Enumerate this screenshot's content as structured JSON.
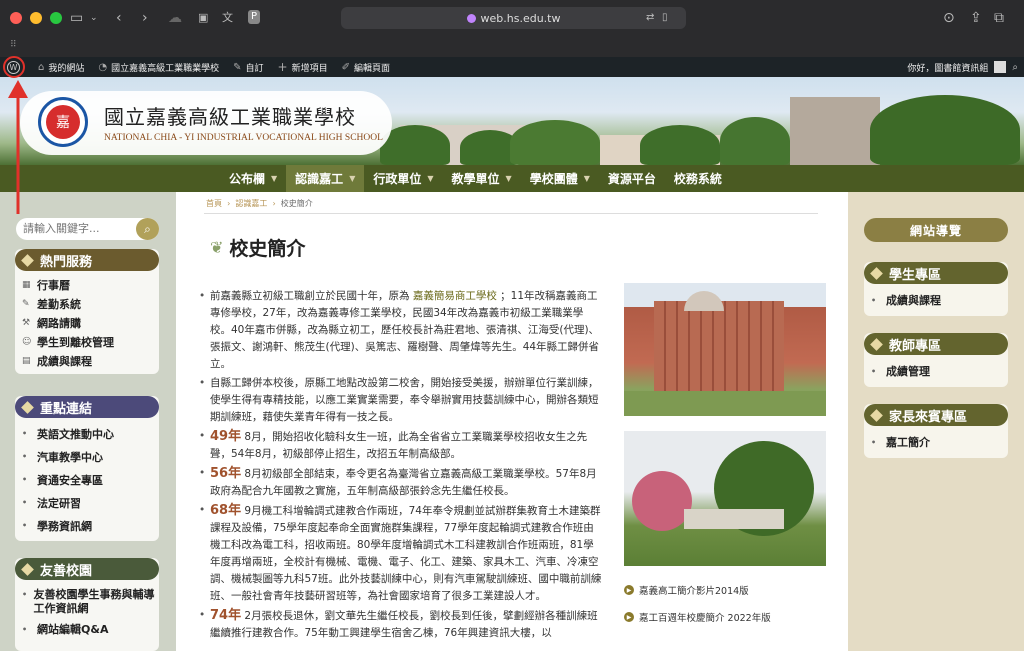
{
  "browser": {
    "url": "web.hs.edu.tw"
  },
  "adminbar": {
    "my_site": "我的網站",
    "site_name": "國立嘉義高級工業職業學校",
    "customize": "自訂",
    "new_item": "新增項目",
    "edit_page": "編輯頁面",
    "greeting": "你好，圖書館資訊組"
  },
  "header": {
    "site_name": "國立嘉義高級工業職業學校",
    "site_name_en": "NATIONAL CHIA - YI INDUSTRIAL VOCATIONAL HIGH SCHOOL",
    "logo_text": "嘉"
  },
  "nav": {
    "items": [
      {
        "label": "公布欄",
        "caret": true
      },
      {
        "label": "認識嘉工",
        "caret": true,
        "active": true
      },
      {
        "label": "行政單位",
        "caret": true
      },
      {
        "label": "教學單位",
        "caret": true
      },
      {
        "label": "學校團體",
        "caret": true
      },
      {
        "label": "資源平台",
        "caret": false
      },
      {
        "label": "校務系統",
        "caret": false
      }
    ]
  },
  "sidebar": {
    "search_placeholder": "請輸入關鍵字...",
    "hot": {
      "title": "熱門服務",
      "color": "#6b5b2e",
      "items": [
        {
          "icon": "calendar-icon",
          "glyph": "▦",
          "label": "行事曆"
        },
        {
          "icon": "pencil-icon",
          "glyph": "✎",
          "label": "差勤系統"
        },
        {
          "icon": "wrench-icon",
          "glyph": "⚒",
          "label": "網路請購"
        },
        {
          "icon": "user-icon",
          "glyph": "☺",
          "label": "學生到離校管理"
        },
        {
          "icon": "list-icon",
          "glyph": "▤",
          "label": "成績與課程"
        }
      ]
    },
    "key": {
      "title": "重點連結",
      "color": "#4c4a7a",
      "items": [
        "英語文推動中心",
        "汽車教學中心",
        "資通安全專區",
        "法定研習",
        "學務資訊網"
      ]
    },
    "friendly": {
      "title": "友善校園",
      "color": "#4a5a3a",
      "items": [
        "友善校園學生事務與輔導工作資訊網",
        "網站編輯Q&A"
      ]
    }
  },
  "breadcrumb": {
    "home": "首頁",
    "sep": "›",
    "section": "認識嘉工",
    "current": "校史簡介"
  },
  "page": {
    "title": "校史簡介"
  },
  "article": {
    "p1_a": "前嘉義縣立初級工職創立於民國十年，原為 ",
    "p1_link": "嘉義簡易商工學校",
    "p1_b": " ；11年改稱嘉義商工專修學校，27年，改為嘉義專修工業學校，民國34年改為嘉義市初級工業職業學校。40年嘉市併縣，改為縣立初工，歷任校長計為莊君地、張清祺、江海受(代理)、張振文、謝鴻軒、熊茂生(代理)、吳篤志、羅樹聲、周肇煒等先生。44年縣工歸併省立。",
    "p2": "自縣工歸併本校後，原縣工地點改設第二校舍，開始接受美援，辦辦單位行業訓練，使學生得有專精技能，以應工業實業需要，奉令舉辦實用技藝訓練中心，開辦各類短期訓練班，藉使失業青年得有一技之長。",
    "y49": "49年",
    "p3": " 8月，開始招收化驗科女生一班，此為全省省立工業職業學校招收女生之先聲，54年8月，初級部停止招生，改招五年制高級部。",
    "y56": "56年",
    "p4": " 8月初級部全部結束，奉令更名為臺灣省立嘉義高級工業職業學校。57年8月政府為配合九年國教之實施，五年制高級部張鈴念先生繼任校長。",
    "y68": "68年",
    "p5": " 9月機工科增輪調式建教合作兩班，74年奉令規劃並試辦群集教育土木建築群課程及設備，75學年度起奉命全面實施群集課程，77學年度起輪調式建教合作班由機工科改為電工科，招收兩班。80學年度增輪調式木工科建教訓合作班兩班，81學年度再增兩班，全校計有機械、電機、電子、化工、建築、家具木工、汽車、冷凍空調、機械製圖等九科57班。此外技藝訓練中心，則有汽車駕駛訓練班、國中職前訓練班、一般社會青年技藝研習班等，為社會國家培育了很多工業建設人才。",
    "y74": "74年",
    "p6": " 2月張校長退休，劉文華先生繼任校長，劉校長到任後，擘劃經辦各種訓練班繼續推行建教合作。75年動工興建學生宿舍乙棟，76年興建資訊大樓，以"
  },
  "videos": {
    "v1": "嘉義高工簡介影片2014版",
    "v2": "嘉工百週年校慶簡介 2022年版"
  },
  "right": {
    "nav_button": "網站導覽",
    "student": {
      "title": "學生專區",
      "items": [
        "成績與課程"
      ]
    },
    "teacher": {
      "title": "教師專區",
      "items": [
        "成績管理"
      ]
    },
    "parent": {
      "title": "家長來賓專區",
      "items": [
        "嘉工簡介"
      ]
    }
  }
}
